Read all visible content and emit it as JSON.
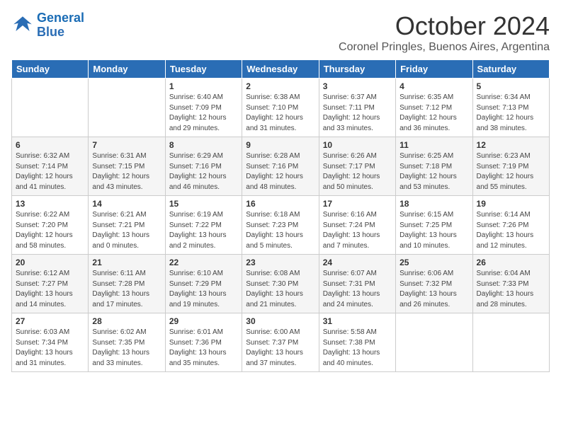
{
  "logo": {
    "line1": "General",
    "line2": "Blue"
  },
  "title": "October 2024",
  "subtitle": "Coronel Pringles, Buenos Aires, Argentina",
  "headers": [
    "Sunday",
    "Monday",
    "Tuesday",
    "Wednesday",
    "Thursday",
    "Friday",
    "Saturday"
  ],
  "weeks": [
    [
      {
        "num": "",
        "info": ""
      },
      {
        "num": "",
        "info": ""
      },
      {
        "num": "1",
        "info": "Sunrise: 6:40 AM\nSunset: 7:09 PM\nDaylight: 12 hours\nand 29 minutes."
      },
      {
        "num": "2",
        "info": "Sunrise: 6:38 AM\nSunset: 7:10 PM\nDaylight: 12 hours\nand 31 minutes."
      },
      {
        "num": "3",
        "info": "Sunrise: 6:37 AM\nSunset: 7:11 PM\nDaylight: 12 hours\nand 33 minutes."
      },
      {
        "num": "4",
        "info": "Sunrise: 6:35 AM\nSunset: 7:12 PM\nDaylight: 12 hours\nand 36 minutes."
      },
      {
        "num": "5",
        "info": "Sunrise: 6:34 AM\nSunset: 7:13 PM\nDaylight: 12 hours\nand 38 minutes."
      }
    ],
    [
      {
        "num": "6",
        "info": "Sunrise: 6:32 AM\nSunset: 7:14 PM\nDaylight: 12 hours\nand 41 minutes."
      },
      {
        "num": "7",
        "info": "Sunrise: 6:31 AM\nSunset: 7:15 PM\nDaylight: 12 hours\nand 43 minutes."
      },
      {
        "num": "8",
        "info": "Sunrise: 6:29 AM\nSunset: 7:16 PM\nDaylight: 12 hours\nand 46 minutes."
      },
      {
        "num": "9",
        "info": "Sunrise: 6:28 AM\nSunset: 7:16 PM\nDaylight: 12 hours\nand 48 minutes."
      },
      {
        "num": "10",
        "info": "Sunrise: 6:26 AM\nSunset: 7:17 PM\nDaylight: 12 hours\nand 50 minutes."
      },
      {
        "num": "11",
        "info": "Sunrise: 6:25 AM\nSunset: 7:18 PM\nDaylight: 12 hours\nand 53 minutes."
      },
      {
        "num": "12",
        "info": "Sunrise: 6:23 AM\nSunset: 7:19 PM\nDaylight: 12 hours\nand 55 minutes."
      }
    ],
    [
      {
        "num": "13",
        "info": "Sunrise: 6:22 AM\nSunset: 7:20 PM\nDaylight: 12 hours\nand 58 minutes."
      },
      {
        "num": "14",
        "info": "Sunrise: 6:21 AM\nSunset: 7:21 PM\nDaylight: 13 hours\nand 0 minutes."
      },
      {
        "num": "15",
        "info": "Sunrise: 6:19 AM\nSunset: 7:22 PM\nDaylight: 13 hours\nand 2 minutes."
      },
      {
        "num": "16",
        "info": "Sunrise: 6:18 AM\nSunset: 7:23 PM\nDaylight: 13 hours\nand 5 minutes."
      },
      {
        "num": "17",
        "info": "Sunrise: 6:16 AM\nSunset: 7:24 PM\nDaylight: 13 hours\nand 7 minutes."
      },
      {
        "num": "18",
        "info": "Sunrise: 6:15 AM\nSunset: 7:25 PM\nDaylight: 13 hours\nand 10 minutes."
      },
      {
        "num": "19",
        "info": "Sunrise: 6:14 AM\nSunset: 7:26 PM\nDaylight: 13 hours\nand 12 minutes."
      }
    ],
    [
      {
        "num": "20",
        "info": "Sunrise: 6:12 AM\nSunset: 7:27 PM\nDaylight: 13 hours\nand 14 minutes."
      },
      {
        "num": "21",
        "info": "Sunrise: 6:11 AM\nSunset: 7:28 PM\nDaylight: 13 hours\nand 17 minutes."
      },
      {
        "num": "22",
        "info": "Sunrise: 6:10 AM\nSunset: 7:29 PM\nDaylight: 13 hours\nand 19 minutes."
      },
      {
        "num": "23",
        "info": "Sunrise: 6:08 AM\nSunset: 7:30 PM\nDaylight: 13 hours\nand 21 minutes."
      },
      {
        "num": "24",
        "info": "Sunrise: 6:07 AM\nSunset: 7:31 PM\nDaylight: 13 hours\nand 24 minutes."
      },
      {
        "num": "25",
        "info": "Sunrise: 6:06 AM\nSunset: 7:32 PM\nDaylight: 13 hours\nand 26 minutes."
      },
      {
        "num": "26",
        "info": "Sunrise: 6:04 AM\nSunset: 7:33 PM\nDaylight: 13 hours\nand 28 minutes."
      }
    ],
    [
      {
        "num": "27",
        "info": "Sunrise: 6:03 AM\nSunset: 7:34 PM\nDaylight: 13 hours\nand 31 minutes."
      },
      {
        "num": "28",
        "info": "Sunrise: 6:02 AM\nSunset: 7:35 PM\nDaylight: 13 hours\nand 33 minutes."
      },
      {
        "num": "29",
        "info": "Sunrise: 6:01 AM\nSunset: 7:36 PM\nDaylight: 13 hours\nand 35 minutes."
      },
      {
        "num": "30",
        "info": "Sunrise: 6:00 AM\nSunset: 7:37 PM\nDaylight: 13 hours\nand 37 minutes."
      },
      {
        "num": "31",
        "info": "Sunrise: 5:58 AM\nSunset: 7:38 PM\nDaylight: 13 hours\nand 40 minutes."
      },
      {
        "num": "",
        "info": ""
      },
      {
        "num": "",
        "info": ""
      }
    ]
  ]
}
